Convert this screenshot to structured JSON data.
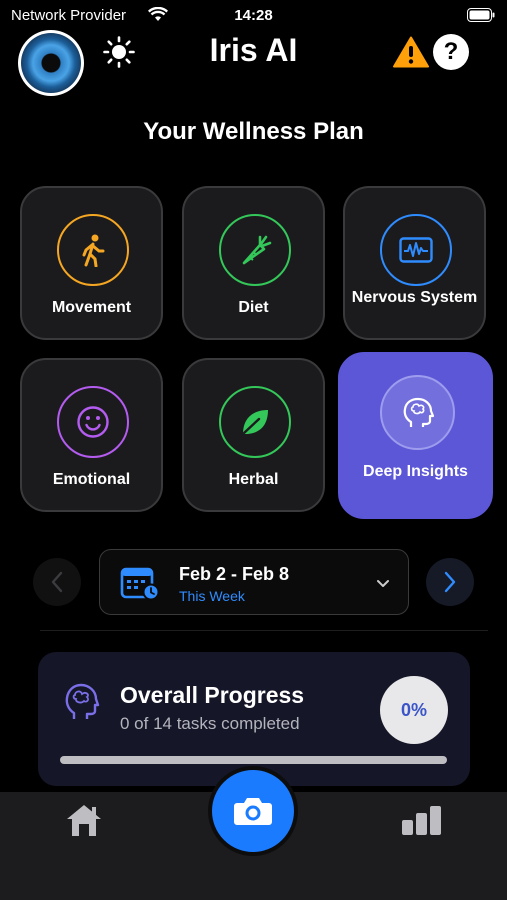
{
  "status_bar": {
    "carrier": "Network Provider",
    "time": "14:28",
    "icons": [
      "wifi-icon",
      "battery-icon"
    ]
  },
  "header": {
    "title": "Iris AI",
    "icons": [
      "iris-avatar",
      "sun-icon",
      "warning-icon",
      "help-icon"
    ],
    "help_glyph": "?"
  },
  "plan_title": "Your Wellness Plan",
  "categories": [
    {
      "label": "Movement",
      "icon": "walking-icon",
      "color": "#f5a623"
    },
    {
      "label": "Diet",
      "icon": "carrot-icon",
      "color": "#34c759"
    },
    {
      "label": "Nervous System",
      "icon": "waveform-monitor-icon",
      "color": "#2f8cff"
    },
    {
      "label": "Emotional",
      "icon": "smiley-icon",
      "color": "#b45cf0"
    },
    {
      "label": "Herbal",
      "icon": "leaf-icon",
      "color": "#34c759"
    },
    {
      "label": "Deep Insights",
      "icon": "brain-head-icon",
      "color": "#ffffff",
      "selected": true
    }
  ],
  "week": {
    "range": "Feb 2 - Feb 8",
    "subtitle": "This Week"
  },
  "progress": {
    "title": "Overall Progress",
    "subtitle": "0 of 14 tasks completed",
    "percent_label": "0%",
    "value": 0
  },
  "tabbar": {
    "items": [
      "home-icon",
      "camera-icon",
      "stats-icon"
    ]
  },
  "colors": {
    "accent": "#2f8cff",
    "selected_tile": "#5b57d6",
    "card_bg": "#151628"
  }
}
